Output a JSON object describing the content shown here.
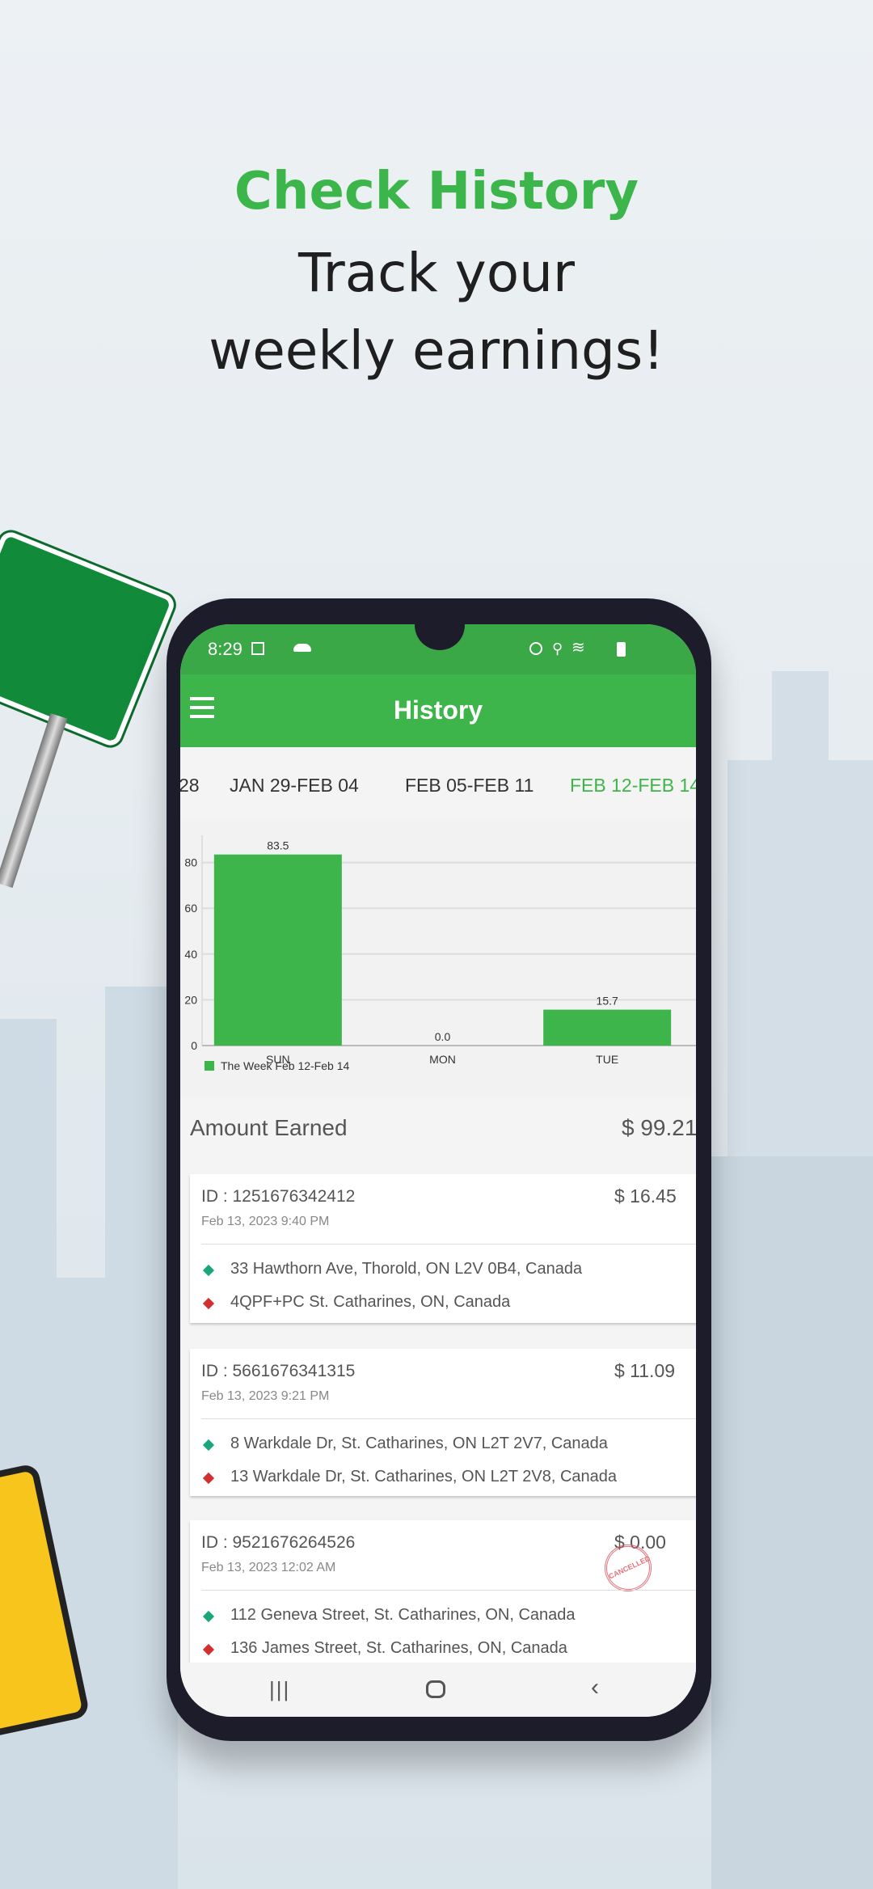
{
  "headline": {
    "title": "Check History",
    "subtitle_line1": "Track your",
    "subtitle_line2": "weekly earnings!"
  },
  "status_bar": {
    "time": "8:29"
  },
  "app_bar": {
    "title": "History",
    "menu_icon": "hamburger-icon"
  },
  "week_tabs": [
    {
      "label": "28",
      "selected": false
    },
    {
      "label": "JAN 29-FEB 04",
      "selected": false
    },
    {
      "label": "FEB 05-FEB 11",
      "selected": false
    },
    {
      "label": "FEB 12-FEB 14",
      "selected": true
    }
  ],
  "colors": {
    "accent": "#3db54a",
    "pickup": "#1aa67a",
    "dropoff": "#d32f2f",
    "cancelled": "#e05a66"
  },
  "chart_data": {
    "type": "bar",
    "categories": [
      "SUN",
      "MON",
      "TUE"
    ],
    "values": [
      83.5,
      0.0,
      15.7
    ],
    "value_labels": [
      "83.5",
      "0.0",
      "15.7"
    ],
    "yticks": [
      "0",
      "20",
      "40",
      "60",
      "80"
    ],
    "ylim": [
      0,
      90
    ],
    "grid": true,
    "legend": "The Week Feb 12-Feb 14",
    "legend_position": "bottom-left"
  },
  "amount_earned": {
    "label": "Amount Earned",
    "value": "$ 99.21"
  },
  "trips": [
    {
      "id": "ID : 1251676342412",
      "date": "Feb 13, 2023 9:40 PM",
      "price": "$ 16.45",
      "pickup": "33 Hawthorn Ave, Thorold, ON L2V 0B4, Canada",
      "dropoff": "4QPF+PC St. Catharines, ON, Canada"
    },
    {
      "id": "ID : 5661676341315",
      "date": "Feb 13, 2023 9:21 PM",
      "price": "$ 11.09",
      "pickup": "8 Warkdale Dr, St. Catharines, ON L2T 2V7, Canada",
      "dropoff": "13 Warkdale Dr, St. Catharines, ON L2T 2V8, Canada"
    },
    {
      "id": "ID : 9521676264526",
      "date": "Feb 13, 2023 12:02 AM",
      "price": "$ 0.00",
      "pickup": "112 Geneva Street, St. Catharines, ON, Canada",
      "dropoff": "136 James Street, St. Catharines, ON, Canada",
      "stamp": "CANCELLED"
    }
  ]
}
